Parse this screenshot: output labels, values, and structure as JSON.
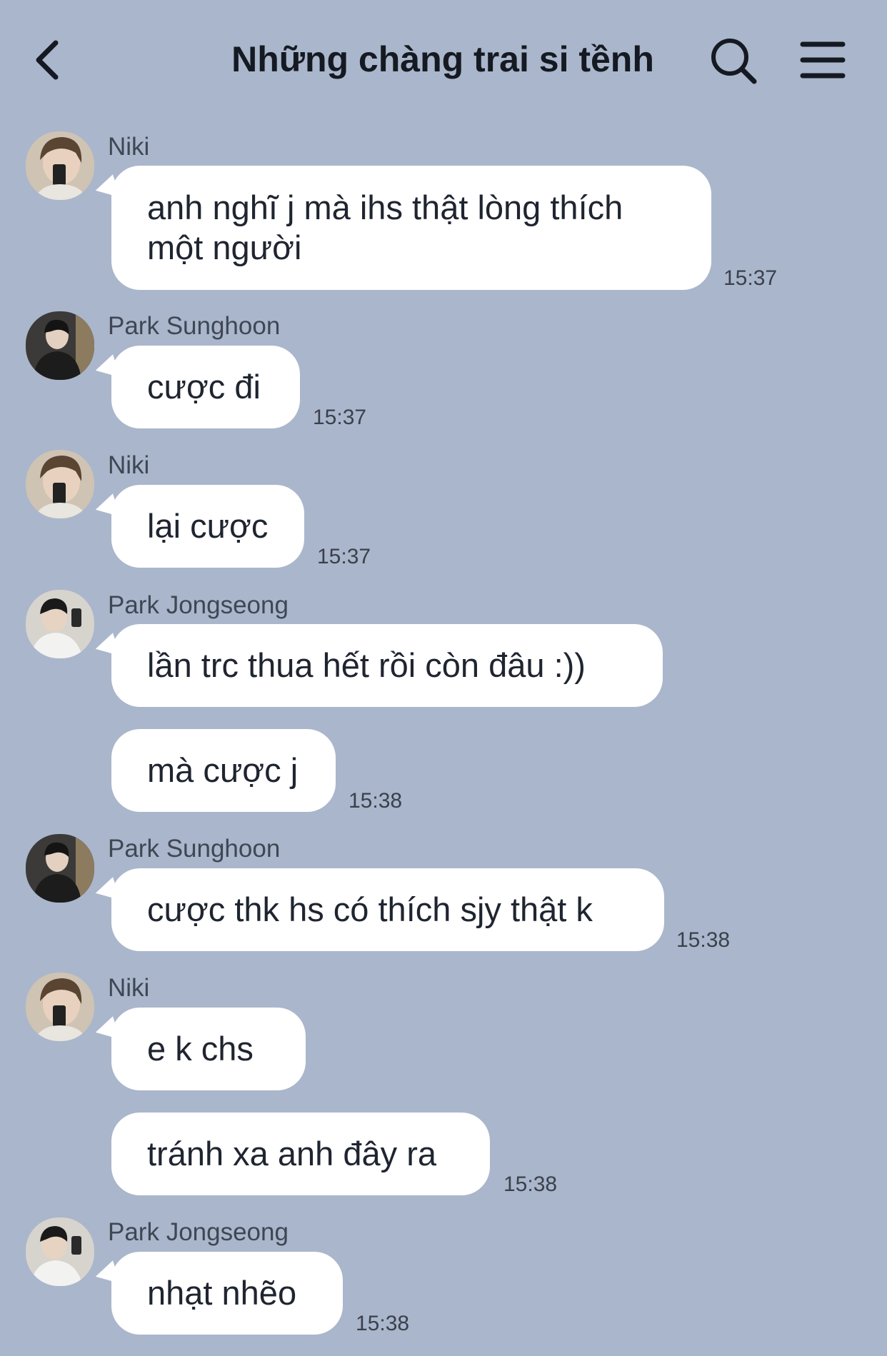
{
  "header": {
    "title": "Những chàng trai si tềnh",
    "back_icon": "chevron-left-icon",
    "search_icon": "search-icon",
    "menu_icon": "menu-icon"
  },
  "messages": [
    {
      "sender": "Niki",
      "bubbles": [
        "anh nghĩ j mà ihs thật lòng thích một người"
      ],
      "time": "15:37"
    },
    {
      "sender": "Park Sunghoon",
      "bubbles": [
        "cược đi"
      ],
      "time": "15:37"
    },
    {
      "sender": "Niki",
      "bubbles": [
        "lại cược"
      ],
      "time": "15:37"
    },
    {
      "sender": "Park Jongseong",
      "bubbles": [
        "lần trc thua hết rồi còn đâu :))",
        "mà cược j"
      ],
      "time": "15:38"
    },
    {
      "sender": "Park Sunghoon",
      "bubbles": [
        "cược thk hs có thích sjy thật k"
      ],
      "time": "15:38"
    },
    {
      "sender": "Niki",
      "bubbles": [
        "e k chs",
        "tránh xa anh đây ra"
      ],
      "time": "15:38"
    },
    {
      "sender": "Park Jongseong",
      "bubbles": [
        "nhạt nhẽo"
      ],
      "time": "15:38"
    }
  ],
  "colors": {
    "background": "#aab6cb",
    "bubble": "#ffffff",
    "text": "#1f2530"
  }
}
